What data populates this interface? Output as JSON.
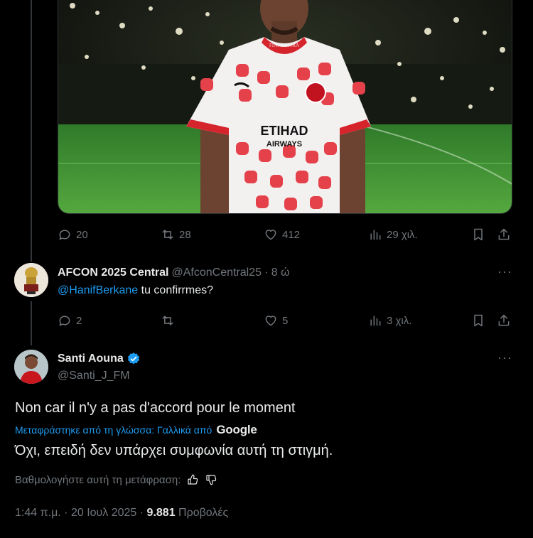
{
  "tweet1": {
    "image_watermark": "FINMF XTRA",
    "shirt_sponsor": "ETIHAD",
    "shirt_sponsor_sub": "AIRWAYS",
    "actions": {
      "replies": "20",
      "reposts": "28",
      "likes": "412",
      "views": "29 χιλ."
    }
  },
  "reply": {
    "name": "AFCON 2025 Central",
    "handle": "@AfconCentral25",
    "time": "· 8 ώ",
    "more": "···",
    "mention": "@HanifBerkane",
    "text": " tu confirrmes?",
    "actions": {
      "replies": "2",
      "reposts": "",
      "likes": "5",
      "views": "3 χιλ."
    }
  },
  "main": {
    "name": "Santi Aouna",
    "handle": "@Santi_J_FM",
    "more": "···",
    "text": "Non car il n'y a pas d'accord pour le moment",
    "translated_label": "Μεταφράστηκε από τη γλώσσα: Γαλλικά από",
    "translator": "Google",
    "translation": "Όχι, επειδή δεν υπάρχει συμφωνία αυτή τη στιγμή.",
    "rate_label": "Βαθμολογήστε αυτή τη μετάφραση:",
    "timestamp": "1:44 π.μ. · 20 Ιουλ 2025 · ",
    "views_count": "9.881",
    "views_label": " Προβολές"
  },
  "colors": {
    "accent": "#1d9bf0",
    "muted": "#71767b",
    "text": "#e7e9ea",
    "bg": "#000000"
  }
}
